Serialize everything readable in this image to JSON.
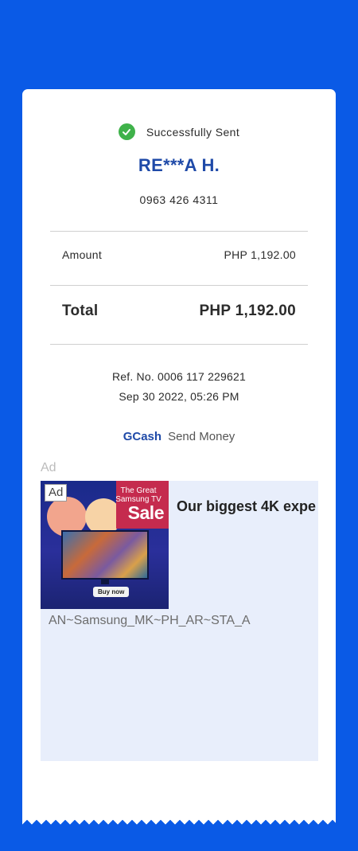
{
  "status": {
    "text": "Successfully Sent",
    "icon": "check-circle-icon",
    "color": "#3fb24a"
  },
  "recipient": {
    "name": "RE***A H.",
    "phone": "0963 426 4311"
  },
  "amount": {
    "label": "Amount",
    "value": "PHP 1,192.00"
  },
  "total": {
    "label": "Total",
    "value": "PHP 1,192.00"
  },
  "reference": {
    "number": "Ref. No. 0006 117 229621",
    "datetime": "Sep 30 2022, 05:26 PM"
  },
  "brand": {
    "name": "GCash",
    "service": "Send Money"
  },
  "ad": {
    "label": "Ad",
    "badge": "Ad",
    "image_sale_small": "The Great Samsung TV",
    "image_sale_big": "Sale",
    "image_buy": "Buy now",
    "headline": "Our biggest 4K expe",
    "caption": "AN~Samsung_MK~PH_AR~STA_A"
  },
  "colors": {
    "background": "#0a5ae6",
    "accent": "#1f4aa8",
    "ad_card": "#e8eefb"
  }
}
